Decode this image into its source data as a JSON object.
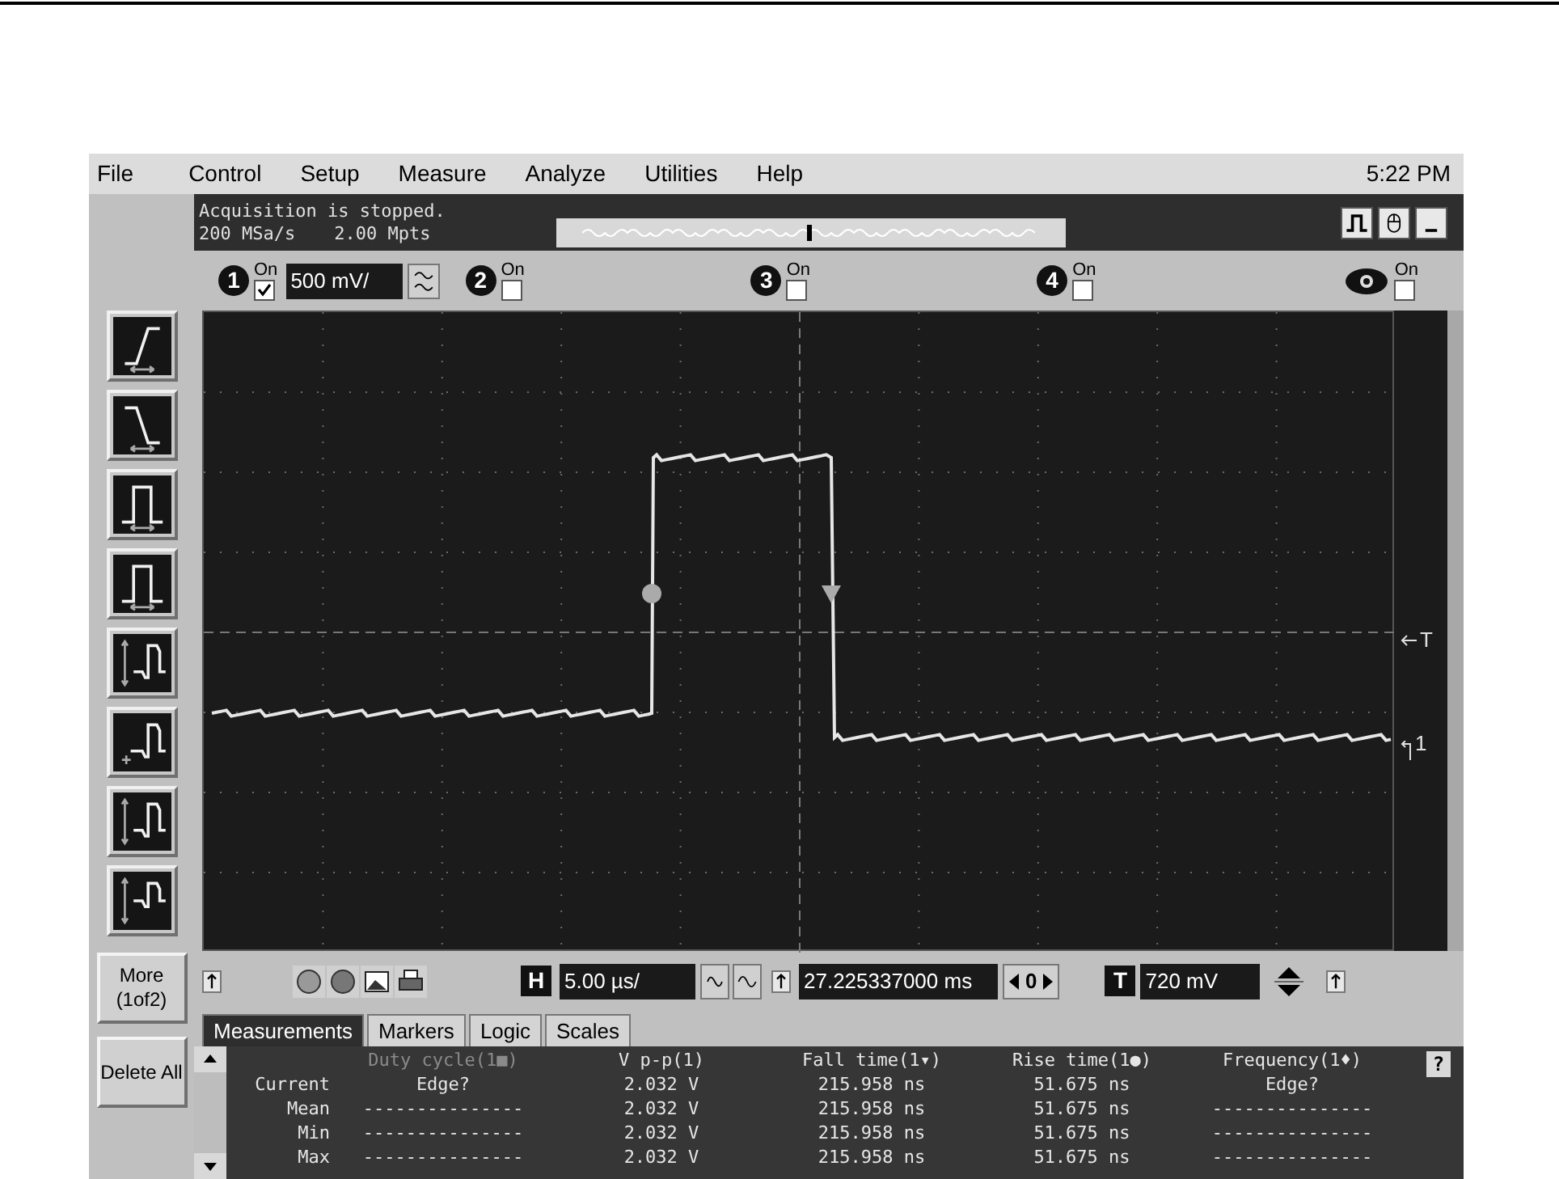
{
  "menu": [
    {
      "label": "File"
    },
    {
      "label": "Control"
    },
    {
      "label": "Setup"
    },
    {
      "label": "Measure"
    },
    {
      "label": "Analyze"
    },
    {
      "label": "Utilities"
    },
    {
      "label": "Help"
    }
  ],
  "clock": "5:22 PM",
  "status": {
    "line_1": "Acquisition is stopped.",
    "sample_rate": "200 MSa/s",
    "memory": "2.00 Mpts"
  },
  "record_position": {
    "level": 0.5
  },
  "channels": [
    {
      "kind": "analog",
      "number": "1",
      "label": "On",
      "checked": true,
      "scale": "500 mV/"
    },
    {
      "kind": "analog",
      "number": "2",
      "label": "On",
      "checked": false
    },
    {
      "kind": "analog",
      "number": "3",
      "label": "On",
      "checked": false
    },
    {
      "kind": "analog",
      "number": "4",
      "label": "On",
      "checked": false
    },
    {
      "kind": "digital",
      "label": "On",
      "checked": false
    }
  ],
  "side_buttons": [
    {
      "label": "More (1of2)"
    },
    {
      "label": "Delete All"
    }
  ],
  "display": {
    "trigger_marker": "T",
    "channel_marker": "1"
  },
  "toolbar": {
    "horizontal_label": "H",
    "timebase": "5.00 µs/",
    "delay": "27.225337000 ms",
    "delay_reference": "0",
    "trigger_label": "T",
    "trigger_level": "720 mV"
  },
  "tabs": [
    {
      "label": "Measurements",
      "selected": true
    },
    {
      "label": "Markers",
      "selected": false
    },
    {
      "label": "Logic",
      "selected": false
    },
    {
      "label": "Scales",
      "selected": false
    }
  ],
  "measurements": {
    "rows": [
      "Current",
      "Mean",
      "Min",
      "Max"
    ],
    "help": "?",
    "columns": [
      {
        "header": "Duty cycle(1■)",
        "disabled": true,
        "values": [
          "Edge?",
          "---------------",
          "---------------",
          "---------------"
        ]
      },
      {
        "header": "V p-p(1)",
        "disabled": false,
        "values": [
          "2.032 V",
          "2.032 V",
          "2.032 V",
          "2.032 V"
        ]
      },
      {
        "header": "Fall time(1▾)",
        "disabled": false,
        "values": [
          "215.958 ns",
          "215.958 ns",
          "215.958 ns",
          "215.958 ns"
        ]
      },
      {
        "header": "Rise time(1●)",
        "disabled": false,
        "values": [
          "51.675 ns",
          "51.675 ns",
          "51.675 ns",
          "51.675 ns"
        ]
      },
      {
        "header": "Frequency(1♦)",
        "disabled": false,
        "values": [
          "Edge?",
          "---------------",
          "---------------",
          "---------------"
        ]
      }
    ]
  }
}
